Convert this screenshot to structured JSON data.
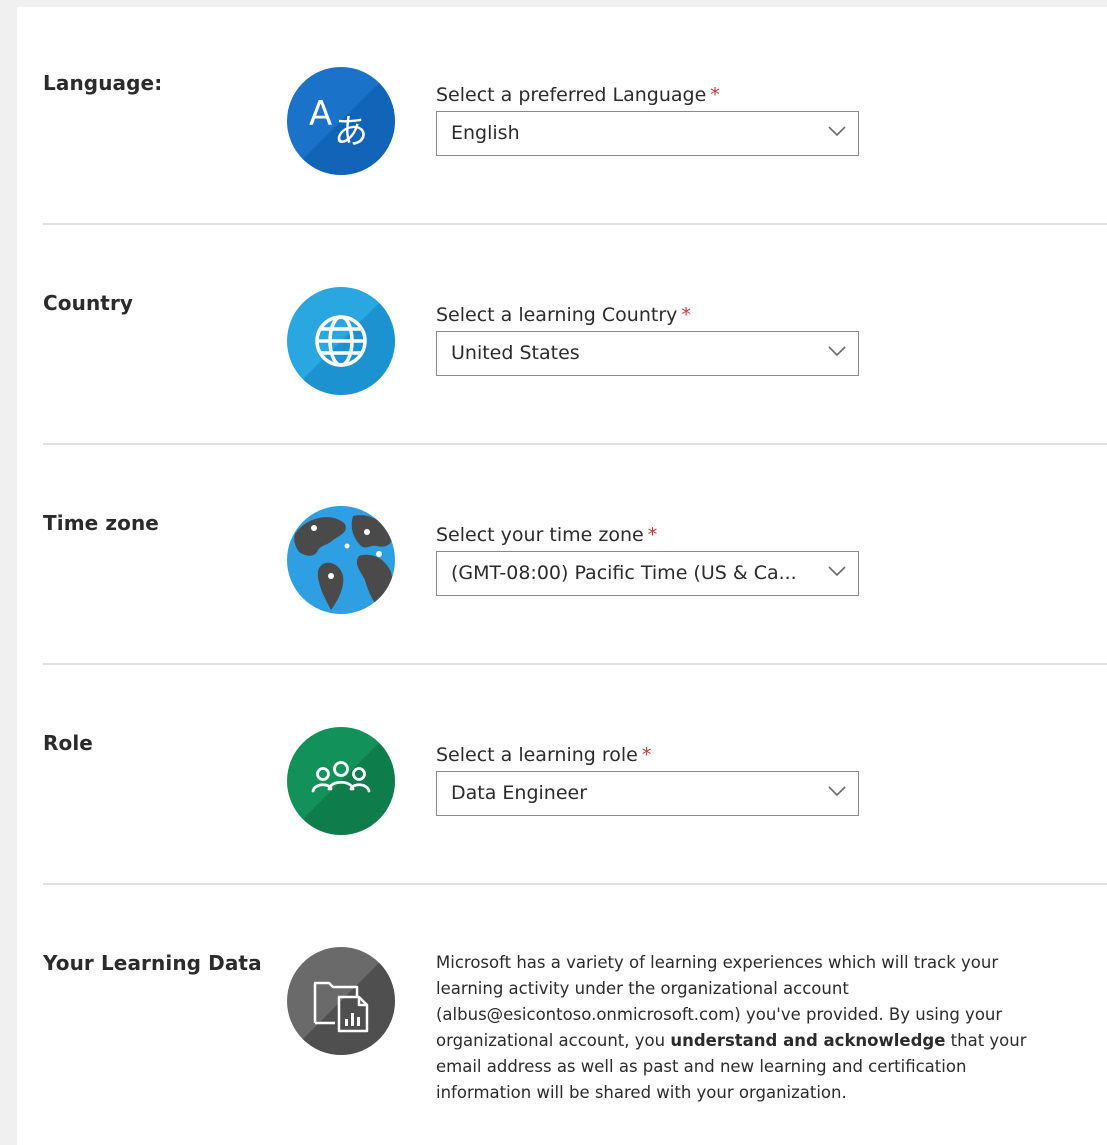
{
  "language": {
    "row_label": "Language:",
    "field_label": "Select a preferred Language",
    "required_mark": "*",
    "selected": "English",
    "icon": "language-translate-icon",
    "icon_color": "#0f6cbd"
  },
  "country": {
    "row_label": "Country",
    "field_label": "Select a learning Country",
    "required_mark": "*",
    "selected": "United States",
    "icon": "globe-icon",
    "icon_color": "#1e9fd9"
  },
  "time_zone": {
    "row_label": "Time zone",
    "field_label": "Select your time zone",
    "required_mark": "*",
    "selected": "(GMT-08:00) Pacific Time (US & Ca...",
    "icon": "world-map-icon",
    "icon_color": "#2e9be0"
  },
  "role": {
    "row_label": "Role",
    "field_label": "Select a learning role",
    "required_mark": "*",
    "selected": "Data Engineer",
    "icon": "people-group-icon",
    "icon_color": "#11804a"
  },
  "learning_data": {
    "row_label": "Your Learning Data",
    "icon": "folder-report-icon",
    "icon_color": "#5a5a5a",
    "text_part1": "Microsoft has a variety of learning experiences which will track your learning activity under the organizational account (albus@esicontoso.onmicrosoft.com)  you've provided. By using your organizational account, you ",
    "text_bold": "understand and acknowledge",
    "text_part2": " that your email address as well as past and new learning and certification information will be shared with your organization."
  },
  "colors": {
    "required": "#c8343a",
    "divider": "#e1e1e1",
    "select_border": "#8a8a8a"
  }
}
